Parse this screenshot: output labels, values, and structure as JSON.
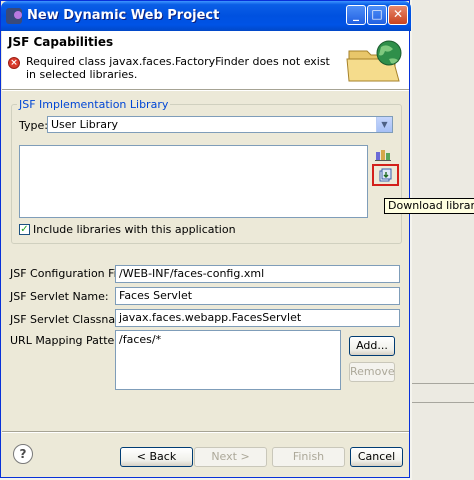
{
  "window": {
    "title": "New Dynamic Web Project",
    "controls": {
      "minimize": "_",
      "maximize": "□",
      "close": "✕"
    }
  },
  "header": {
    "title": "JSF Capabilities",
    "error_message": "Required class javax.faces.FactoryFinder does not exist in selected libraries.",
    "error_icon": "error-x-icon"
  },
  "implementation_library": {
    "group_title": "JSF Implementation Library",
    "type_label": "Type:",
    "type_value": "User Library",
    "libraries": [],
    "include_label": "Include libraries with this application",
    "include_checked": true,
    "download_tooltip": "Download library..."
  },
  "fields": {
    "config_file_label": "JSF Configuration File:",
    "config_file_value": "/WEB-INF/faces-config.xml",
    "servlet_name_label": "JSF Servlet Name:",
    "servlet_name_value": "Faces Servlet",
    "servlet_class_label": "JSF Servlet Classname:",
    "servlet_class_value": "javax.faces.webapp.FacesServlet",
    "url_patterns_label": "URL Mapping Patterns:",
    "url_patterns": [
      "/faces/*"
    ],
    "add_label": "Add...",
    "remove_label": "Remove"
  },
  "footer": {
    "help": "?",
    "back_label": "< Back",
    "next_label": "Next >",
    "finish_label": "Finish",
    "cancel_label": "Cancel"
  },
  "colors": {
    "titlebar": "#0053e6",
    "group_title": "#0046d5",
    "highlight_box": "#d3201b",
    "tooltip_bg": "#ffffe1"
  }
}
